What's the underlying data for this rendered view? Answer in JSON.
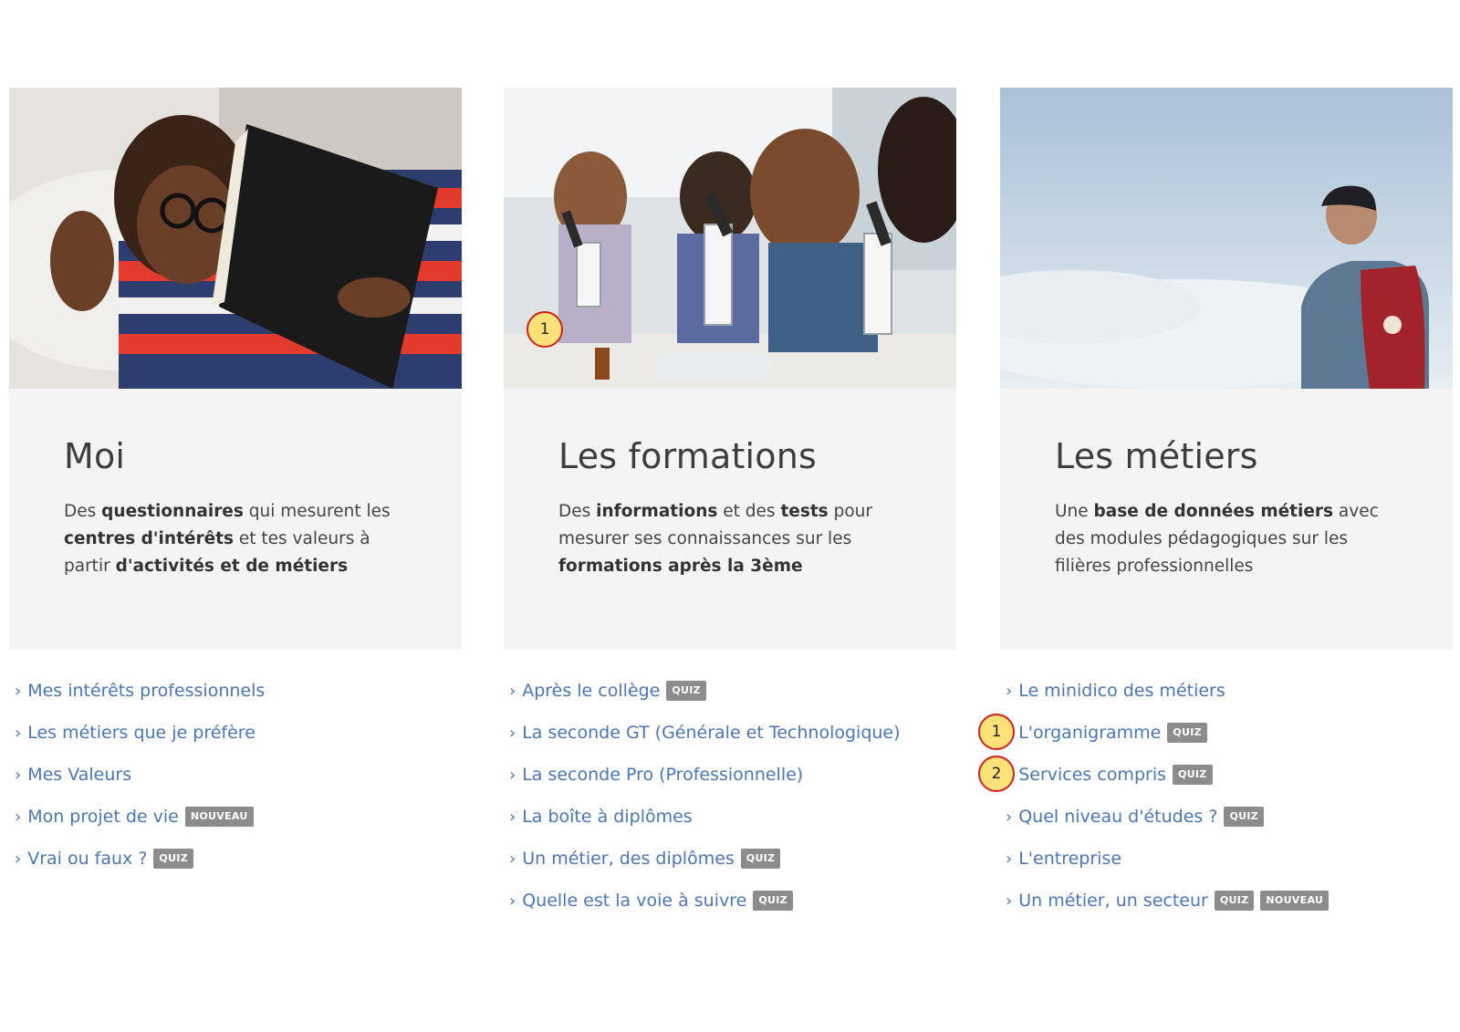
{
  "columns": [
    {
      "title": "Moi",
      "photo_icon": "student-reading-photo",
      "desc": [
        {
          "t": "Des ",
          "b": false
        },
        {
          "t": "questionnaires",
          "b": true
        },
        {
          "t": " qui mesurent les ",
          "b": false
        },
        {
          "t": "centres d'intérêts",
          "b": true
        },
        {
          "t": " et tes valeurs à partir ",
          "b": false
        },
        {
          "t": "d'activités et de métiers",
          "b": true
        }
      ],
      "links": [
        {
          "label": "Mes intérêts professionnels",
          "badges": []
        },
        {
          "label": "Les métiers que je préfère",
          "badges": []
        },
        {
          "label": "Mes Valeurs",
          "badges": []
        },
        {
          "label": "Mon projet de vie",
          "badges": [
            "NOUVEAU"
          ]
        },
        {
          "label": "Vrai ou faux ?",
          "badges": [
            "QUIZ"
          ]
        }
      ]
    },
    {
      "title": "Les formations",
      "photo_icon": "students-microscopes-photo",
      "desc": [
        {
          "t": "Des ",
          "b": false
        },
        {
          "t": "informations",
          "b": true
        },
        {
          "t": " et des ",
          "b": false
        },
        {
          "t": "tests",
          "b": true
        },
        {
          "t": " pour mesurer ses connaissances sur les ",
          "b": false
        },
        {
          "t": "formations après la 3ème",
          "b": true
        }
      ],
      "links": [
        {
          "label": "Après le collège",
          "badges": [
            "QUIZ"
          ]
        },
        {
          "label": "La seconde GT (Générale et Technologique)",
          "badges": []
        },
        {
          "label": "La seconde Pro (Professionnelle)",
          "badges": []
        },
        {
          "label": "La boîte à diplômes",
          "badges": []
        },
        {
          "label": "Un métier, des diplômes",
          "badges": [
            "QUIZ"
          ]
        },
        {
          "label": "Quelle est la voie à suivre",
          "badges": [
            "QUIZ"
          ]
        }
      ]
    },
    {
      "title": "Les métiers",
      "photo_icon": "hiker-sky-photo",
      "desc": [
        {
          "t": "Une ",
          "b": false
        },
        {
          "t": "base de données métiers",
          "b": true
        },
        {
          "t": " avec des modules pédagogiques sur les filières professionnelles",
          "b": false
        }
      ],
      "links": [
        {
          "label": "Le minidico des métiers",
          "badges": []
        },
        {
          "label": "L'organigramme",
          "badges": [
            "QUIZ"
          ]
        },
        {
          "label": "Services compris",
          "badges": [
            "QUIZ"
          ]
        },
        {
          "label": "Quel niveau d'études ?",
          "badges": [
            "QUIZ"
          ]
        },
        {
          "label": "L'entreprise",
          "badges": []
        },
        {
          "label": "Un métier, un secteur",
          "badges": [
            "QUIZ",
            "NOUVEAU"
          ]
        }
      ]
    }
  ],
  "markers": [
    "1",
    "1",
    "2"
  ],
  "colors": {
    "link": "#4a76b8",
    "badge": "#8c8c8c",
    "card_bg": "#f4f4f4",
    "marker_fill": "#fde27a",
    "marker_border": "#d2201c"
  }
}
